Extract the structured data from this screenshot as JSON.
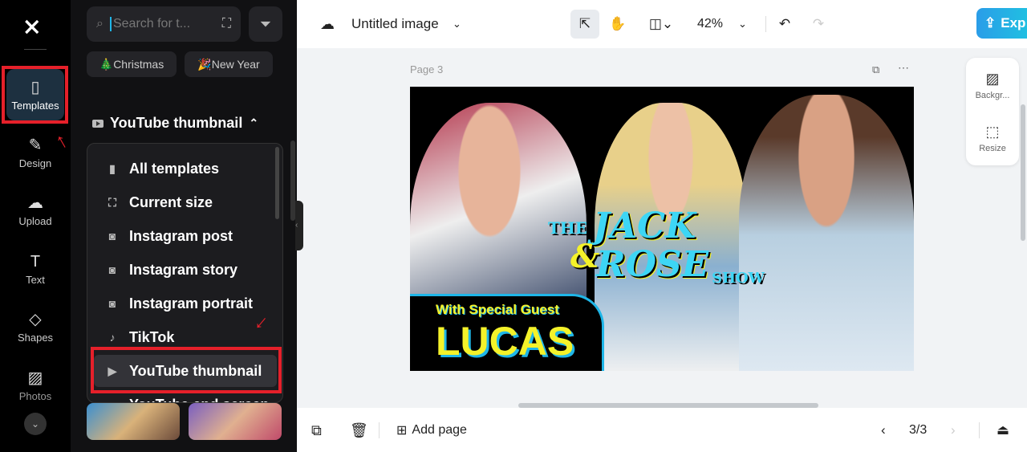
{
  "rail": {
    "items": [
      {
        "label": "Templates"
      },
      {
        "label": "Design"
      },
      {
        "label": "Upload"
      },
      {
        "label": "Text"
      },
      {
        "label": "Shapes"
      },
      {
        "label": "Photos"
      }
    ]
  },
  "panel": {
    "search_placeholder": "Search for t...",
    "chips": [
      "🎄Christmas",
      "🎉New Year"
    ],
    "section_title": "YouTube thumbnail",
    "menu": [
      "All templates",
      "Current size",
      "Instagram post",
      "Instagram story",
      "Instagram portrait",
      "TikTok",
      "YouTube thumbnail",
      "YouTube end screen"
    ],
    "selected": "YouTube thumbnail"
  },
  "topbar": {
    "title": "Untitled image",
    "zoom": "42%",
    "export_label": "Exp"
  },
  "canvas": {
    "page_label": "Page 3",
    "design": {
      "line1": "THE",
      "line2": "JACK",
      "amp": "&",
      "line3": "ROSE",
      "line4": "SHOW",
      "guest_label": "With Special Guest",
      "guest_name": "LUCAS"
    }
  },
  "right_panel": {
    "background_label": "Backgr...",
    "resize_label": "Resize"
  },
  "bottombar": {
    "add_page_label": "Add page",
    "page_indicator": "3/3"
  },
  "colors": {
    "accent": "#1fb6e8",
    "highlight": "#e5202a",
    "title_cyan": "#3dd6f5",
    "title_yellow": "#f4f22a"
  }
}
